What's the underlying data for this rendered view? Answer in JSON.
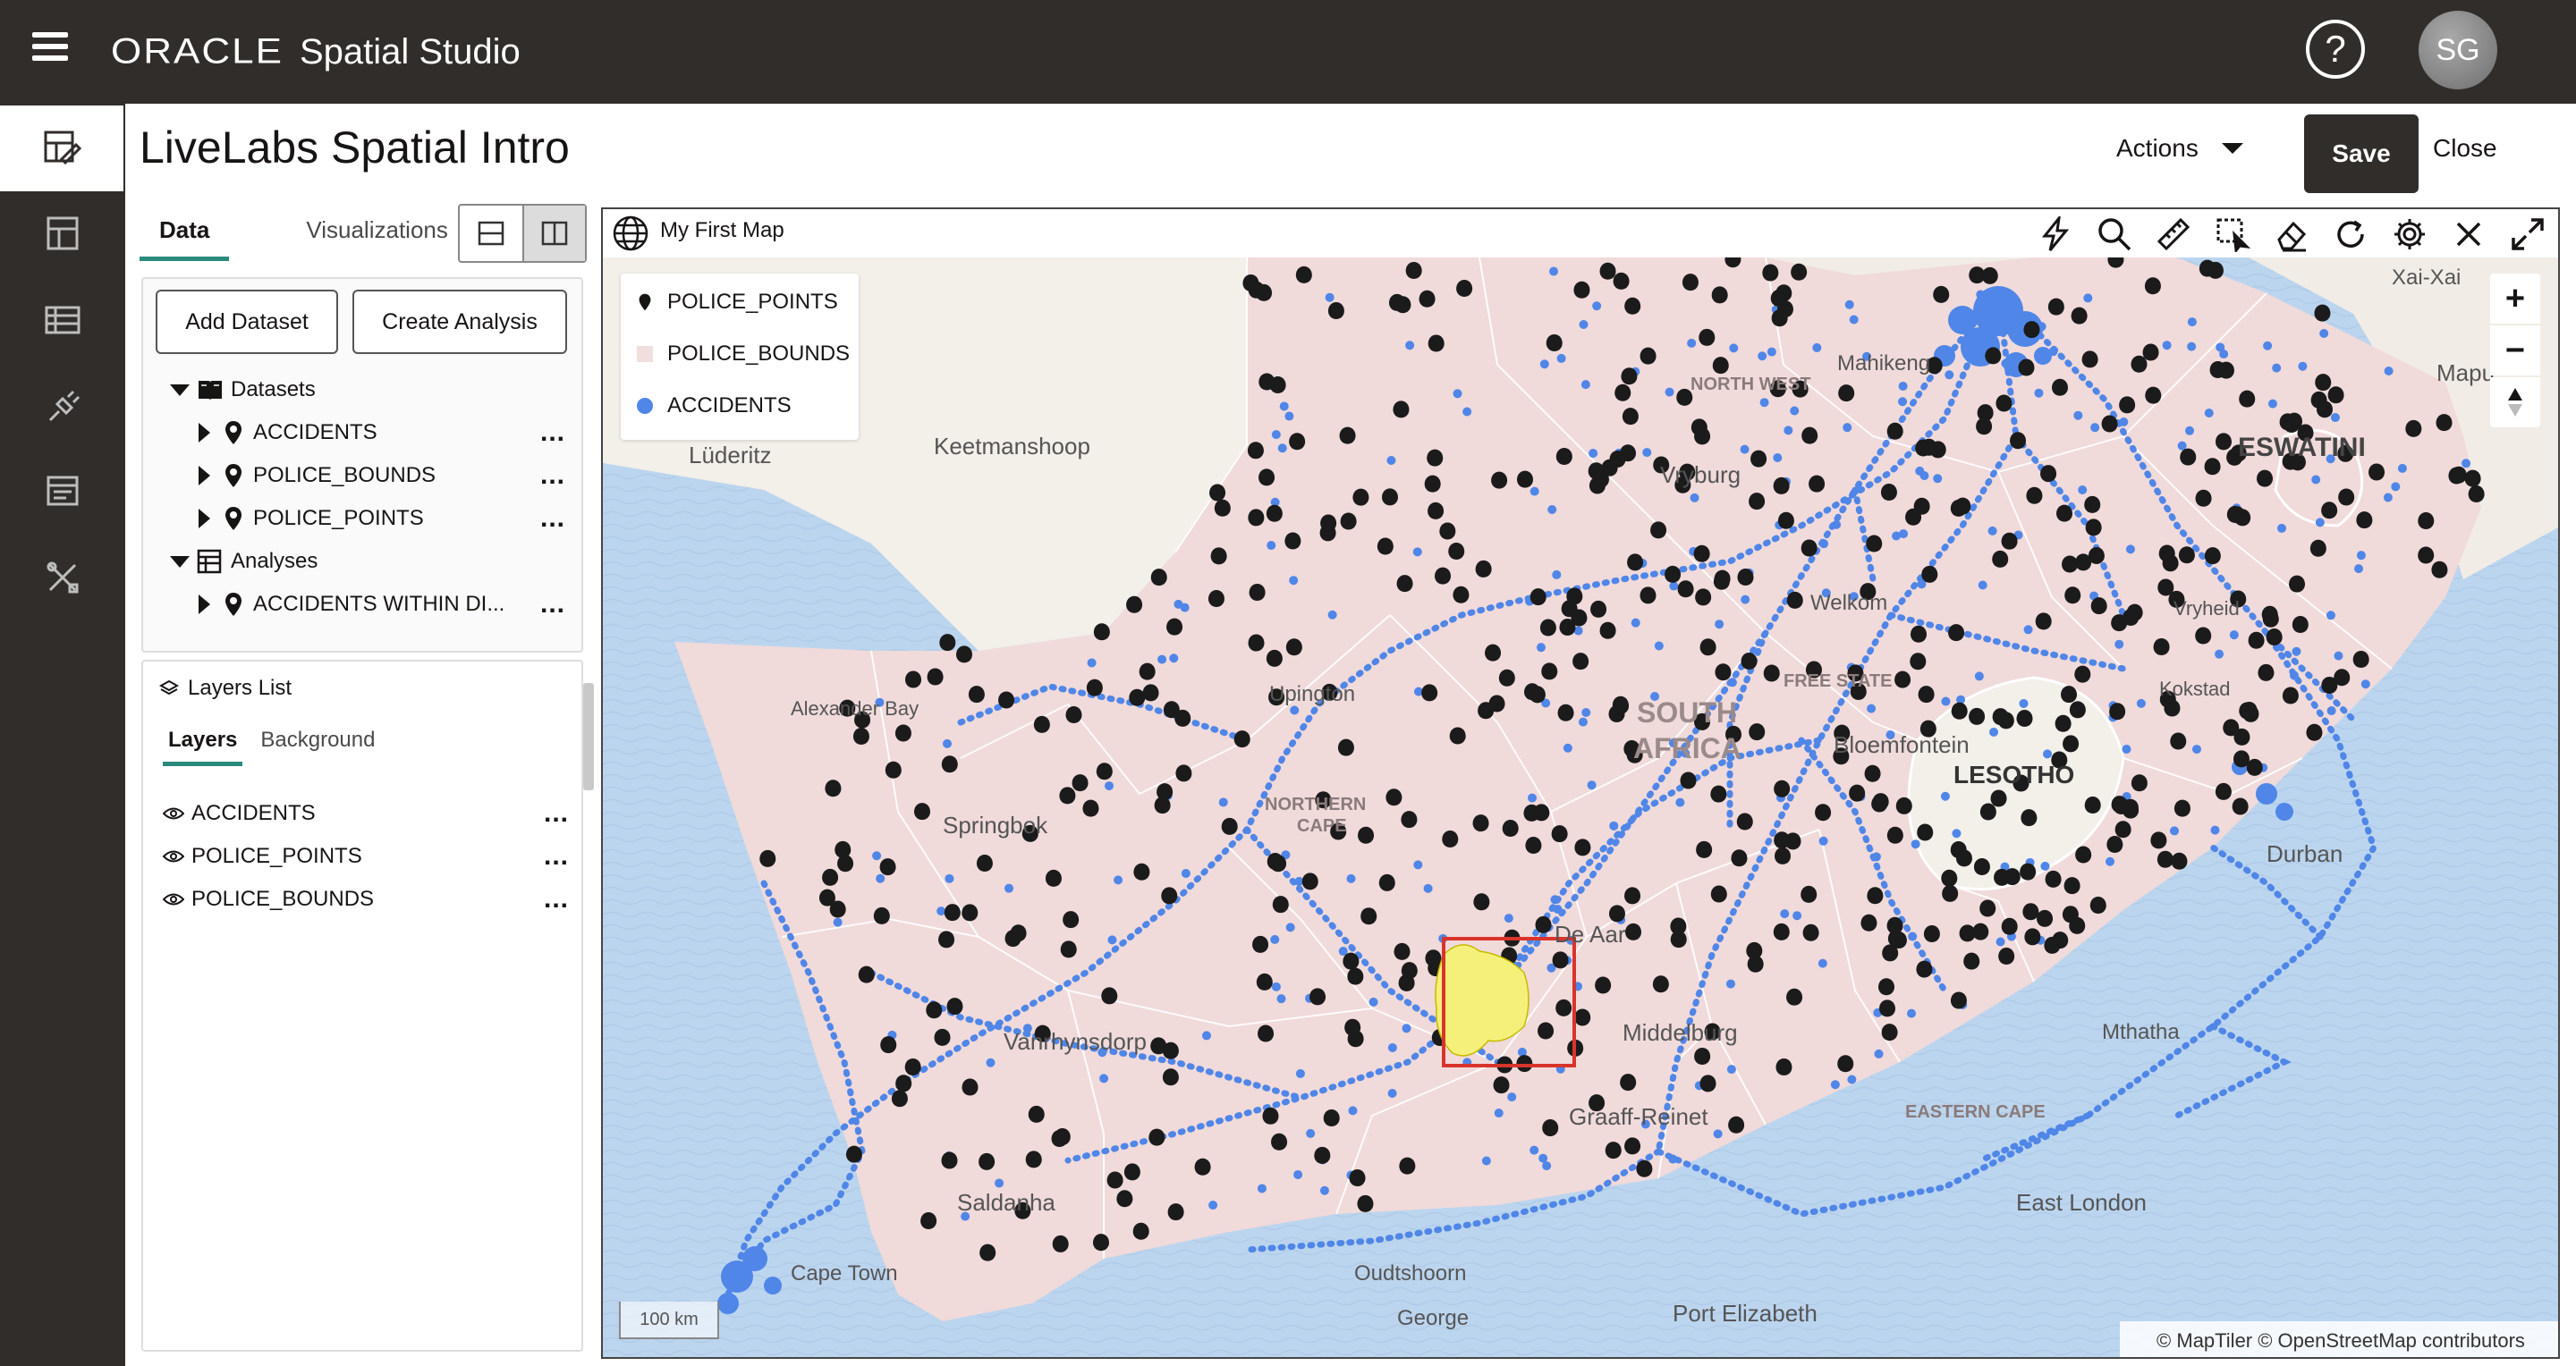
{
  "app": {
    "brand": "ORACLE",
    "product": "Spatial Studio",
    "help_icon": "?",
    "user_initials": "SG"
  },
  "nav": [
    {
      "icon": "project-edit-icon",
      "active": true
    },
    {
      "icon": "dashboard-icon",
      "active": false
    },
    {
      "icon": "table-icon",
      "active": false
    },
    {
      "icon": "connection-icon",
      "active": false
    },
    {
      "icon": "jobs-icon",
      "active": false
    },
    {
      "icon": "tools-icon",
      "active": false
    }
  ],
  "header": {
    "title": "LiveLabs Spatial Intro",
    "actions_label": "Actions",
    "save_label": "Save",
    "close_label": "Close"
  },
  "data_panel": {
    "tabs": [
      "Data",
      "Visualizations"
    ],
    "active_tab": "Data",
    "add_dataset_label": "Add Dataset",
    "create_analysis_label": "Create Analysis",
    "datasets_label": "Datasets",
    "datasets": [
      "ACCIDENTS",
      "POLICE_BOUNDS",
      "POLICE_POINTS"
    ],
    "analyses_label": "Analyses",
    "analyses": [
      "ACCIDENTS WITHIN DI..."
    ],
    "more_label": "..."
  },
  "layers_panel": {
    "title": "Layers List",
    "tabs": [
      "Layers",
      "Background"
    ],
    "active_tab": "Layers",
    "layers": [
      "ACCIDENTS",
      "POLICE_POINTS",
      "POLICE_BOUNDS"
    ]
  },
  "map": {
    "title": "My First Map",
    "legend": [
      "POLICE_POINTS",
      "POLICE_BOUNDS",
      "ACCIDENTS"
    ],
    "colors": {
      "accidents": "#4f86e8",
      "police_bounds_fill": "#f2dede",
      "ocean": "#b8d3ec",
      "highlight": "#f5f07a",
      "selection": "#d9342b"
    },
    "zoom_in": "+",
    "zoom_out": "−",
    "scale_label": "100 km",
    "attribution": "© MapTiler  © OpenStreetMap contributors",
    "places": {
      "keetmanshoop": "Keetmanshoop",
      "luderitz": "Lüderitz",
      "alexander_bay": "Alexander Bay",
      "upington": "Upington",
      "springbok": "Springbok",
      "northern_cape_1": "NORTHERN",
      "northern_cape_2": "CAPE",
      "south_africa_1": "SOUTH",
      "south_africa_2": "AFRICA",
      "lesotho": "LESOTHO",
      "eswatini": "ESWATINI",
      "maputo": "Mapu",
      "vryburg": "Vryburg",
      "north_west": "NORTH WEST",
      "free_state": "FREE STATE",
      "bloemfontein": "Bloemfontein",
      "welkom": "Welkom",
      "de_aar": "De Aar",
      "middelburg": "Middelburg",
      "graaff_reinet": "Graaff-Reinet",
      "eastern_cape": "EASTERN CAPE",
      "mthatha": "Mthatha",
      "durban": "Durban",
      "east_london": "East London",
      "port_elizabeth": "Port Elizabeth",
      "oudtshoorn": "Oudtshoorn",
      "george": "George",
      "saldanha": "Saldanha",
      "vanrhynsdorp": "Vanrhynsdorp",
      "cape_town": "Cape Town",
      "mafikeng": "Mahikeng",
      "xai_xai": "Xai-Xai",
      "vryheid": "Vryheid",
      "kokstad": "Kokstad"
    }
  }
}
